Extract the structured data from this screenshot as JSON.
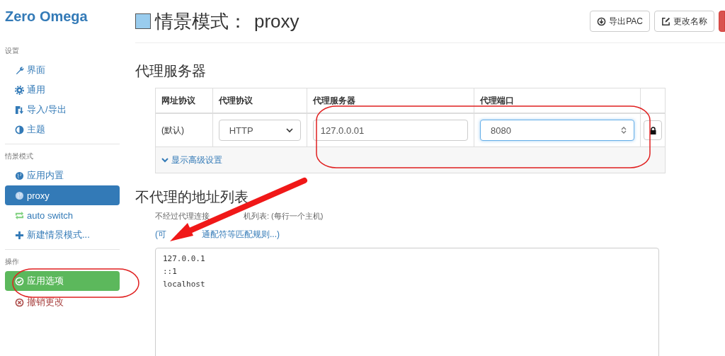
{
  "app_title": "Zero Omega",
  "sidebar": {
    "sections": [
      {
        "heading": "设置",
        "items": [
          {
            "kind": "nav",
            "label": "界面",
            "selected": false
          },
          {
            "kind": "nav",
            "label": "通用",
            "selected": false
          },
          {
            "kind": "nav",
            "label": "导入/导出",
            "selected": false
          },
          {
            "kind": "nav",
            "label": "主题",
            "selected": false
          }
        ]
      },
      {
        "heading": "情景模式",
        "items": [
          {
            "kind": "nav",
            "label": "应用内置",
            "selected": false
          },
          {
            "kind": "nav",
            "label": "proxy",
            "selected": true
          },
          {
            "kind": "nav",
            "label": "auto switch",
            "selected": false
          },
          {
            "kind": "nav",
            "label": "新建情景模式...",
            "selected": false
          }
        ]
      },
      {
        "heading": "操作",
        "items": [
          {
            "kind": "apply",
            "label": "应用选项"
          },
          {
            "kind": "discard",
            "label": "撤销更改"
          }
        ]
      }
    ]
  },
  "header": {
    "color": "#99ccee",
    "title": "情景模式：",
    "profile_name": "proxy",
    "buttons": [
      {
        "kind": "default",
        "label": "导出PAC"
      },
      {
        "kind": "default",
        "label": "更改名称"
      },
      {
        "kind": "danger"
      }
    ]
  },
  "proxy_servers": {
    "title": "代理服务器",
    "columns": [
      "网址协议",
      "代理协议",
      "代理服务器",
      "代理端口"
    ],
    "rows": [
      {
        "scheme": "(默认)",
        "protocol": "HTTP",
        "host": "127.0.0.01",
        "port": "8080",
        "port_focused": true
      }
    ],
    "advanced_link": "显示高级设置"
  },
  "bypass": {
    "title": "不代理的地址列表",
    "help_parts": [
      "不经过代理连接",
      "机列表: (每行一个主机)"
    ],
    "link_parts": [
      "(可",
      "通配符等匹配规则...)"
    ],
    "lines": [
      "127.0.0.1",
      "::1",
      "localhost"
    ]
  },
  "annotations": [
    {
      "kind": "ellipse"
    },
    {
      "kind": "ellipse"
    },
    {
      "kind": "arrow"
    }
  ]
}
